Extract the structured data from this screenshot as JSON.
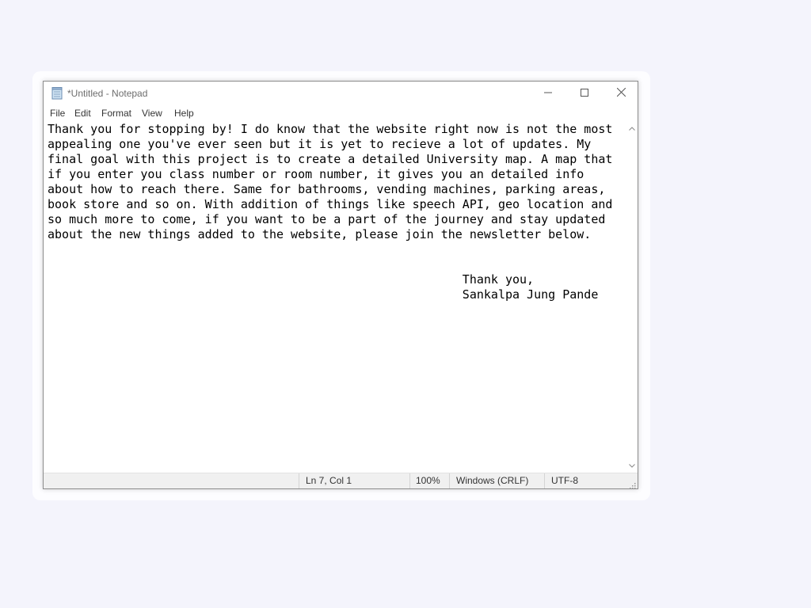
{
  "window": {
    "title": "*Untitled - Notepad",
    "app_icon": "notepad-icon",
    "controls": {
      "minimize_icon": "minimize-icon",
      "maximize_icon": "maximize-icon",
      "close_icon": "close-icon"
    }
  },
  "menu": {
    "items": [
      "File",
      "Edit",
      "Format",
      "View",
      "Help"
    ]
  },
  "editor": {
    "content": "Thank you for stopping by! I do know that the website right now is not the most\nappealing one you've ever seen but it is yet to recieve a lot of updates. My\nfinal goal with this project is to create a detailed University map. A map that\nif you enter you class number or room number, it gives you an detailed info\nabout how to reach there. Same for bathrooms, vending machines, parking areas,\nbook store and so on. With addition of things like speech API, geo location and\nso much more to come, if you want to be a part of the journey and stay updated\nabout the new things added to the website, please join the newsletter below.\n\n\n                                                          Thank you,\n                                                          Sankalpa Jung Pande"
  },
  "status": {
    "position": "Ln 7, Col 1",
    "zoom": "100%",
    "line_ending": "Windows (CRLF)",
    "encoding": "UTF-8"
  },
  "colors": {
    "background": "#f4f4fc",
    "window_border": "#8c8c8c",
    "status_bar": "#f0f0f0"
  }
}
